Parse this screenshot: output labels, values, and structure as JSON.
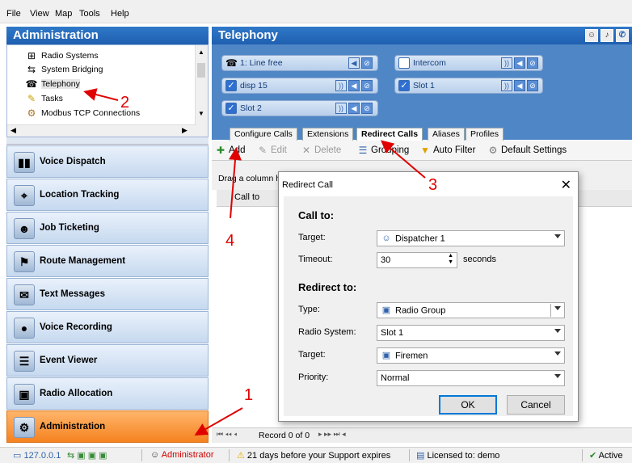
{
  "menu": [
    "File",
    "View",
    "Map",
    "Tools",
    "Help"
  ],
  "left": {
    "title": "Administration",
    "tree": [
      {
        "label": "Radio Systems",
        "icon": "radio-systems-icon"
      },
      {
        "label": "System Bridging",
        "icon": "bridging-icon"
      },
      {
        "label": "Telephony",
        "icon": "telephony-icon"
      },
      {
        "label": "Tasks",
        "icon": "tasks-icon"
      },
      {
        "label": "Modbus TCP Connections",
        "icon": "modbus-icon"
      }
    ],
    "nav": [
      {
        "label": "Voice Dispatch",
        "icon": "voice-dispatch-icon",
        "glyph": "📶"
      },
      {
        "label": "Location Tracking",
        "icon": "location-tracking-icon",
        "glyph": "🗺"
      },
      {
        "label": "Job Ticketing",
        "icon": "job-ticketing-icon",
        "glyph": "👥"
      },
      {
        "label": "Route Management",
        "icon": "route-management-icon",
        "glyph": "📍"
      },
      {
        "label": "Text Messages",
        "icon": "text-messages-icon",
        "glyph": "✉"
      },
      {
        "label": "Voice Recording",
        "icon": "voice-recording-icon",
        "glyph": "🎙"
      },
      {
        "label": "Event Viewer",
        "icon": "event-viewer-icon",
        "glyph": "📋"
      },
      {
        "label": "Radio Allocation",
        "icon": "radio-allocation-icon",
        "glyph": "📻"
      },
      {
        "label": "Administration",
        "icon": "administration-icon",
        "glyph": "🚗",
        "active": true
      }
    ]
  },
  "right": {
    "title": "Telephony",
    "calls": [
      {
        "label": "1: Line free",
        "checked": false
      },
      {
        "label": "Intercom",
        "checked": false
      },
      {
        "label": "disp 15",
        "checked": true
      },
      {
        "label": "Slot 1",
        "checked": true
      },
      {
        "label": "Slot 2",
        "checked": true
      }
    ],
    "tabs": [
      "Configure Calls",
      "Extensions",
      "Redirect Calls",
      "Aliases",
      "Profiles"
    ],
    "active_tab": "Redirect Calls",
    "toolbar": {
      "add": "Add",
      "edit": "Edit",
      "delete": "Delete",
      "grouping": "Grouping",
      "auto_filter": "Auto Filter",
      "default_settings": "Default Settings"
    },
    "grid": {
      "group_hint": "Drag a column h",
      "column": "Call to"
    },
    "pager": {
      "record": "Record 0 of 0"
    }
  },
  "dialog": {
    "title": "Redirect Call",
    "call_to": "Call to:",
    "target_label": "Target:",
    "target_value": "Dispatcher 1",
    "timeout_label": "Timeout:",
    "timeout_value": "30",
    "timeout_unit": "seconds",
    "redirect_to": "Redirect to:",
    "type_label": "Type:",
    "type_value": "Radio Group",
    "radio_system_label": "Radio System:",
    "radio_system_value": "Slot 1",
    "target2_label": "Target:",
    "target2_value": "Firemen",
    "priority_label": "Priority:",
    "priority_value": "Normal",
    "ok": "OK",
    "cancel": "Cancel"
  },
  "status": {
    "ip": "127.0.0.1",
    "user": "Administrator",
    "support": "21 days before your Support expires",
    "license": "Licensed to: demo",
    "state": "Active"
  },
  "annotations": [
    "1",
    "2",
    "3",
    "4"
  ],
  "colors": {
    "accent": "#2f78c8",
    "active_nav": "#f58220",
    "annotation": "#e00000"
  }
}
